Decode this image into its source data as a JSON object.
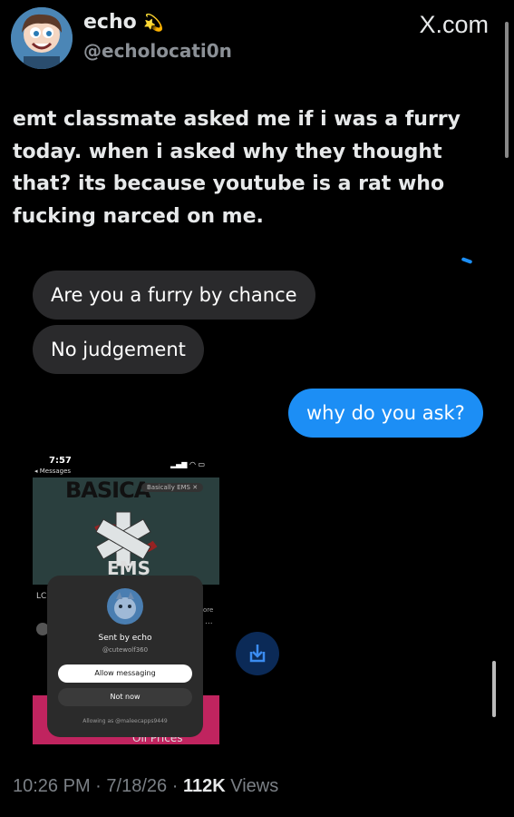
{
  "header": {
    "display_name": "echo",
    "name_emoji": "💫",
    "handle": "@echolocati0n",
    "brand": "X.com"
  },
  "tweet": {
    "lines": [
      "emt classmate asked me if i was a furry",
      "today. when i asked why they thought",
      "that? its because youtube is a rat who",
      "fucking narced on me."
    ]
  },
  "chat": {
    "messages": [
      {
        "text": "Are you a furry by chance",
        "from": "other"
      },
      {
        "text": "No judgement",
        "from": "other"
      },
      {
        "text": "why do you ask?",
        "from": "me"
      }
    ]
  },
  "phone": {
    "time": "7:57",
    "back_label": "◂ Messages",
    "banner_text": "BASICA",
    "pill_text": "Basically EMS",
    "logo_text": "EMS",
    "left_fragment": "LC",
    "right_fragment": "ore",
    "dots": "...",
    "bottom_text": "Oil Prices",
    "modal": {
      "sent_by": "Sent by echo",
      "user": "@cutewolf360",
      "allow_label": "Allow messaging",
      "not_now_label": "Not now",
      "allowing_as": "Allowing as @maleecapps9449"
    }
  },
  "footer": {
    "time": "10:26 PM",
    "date": "7/18/26",
    "views_count": "112K",
    "views_label": "Views"
  },
  "colors": {
    "bubble_gray": "#2a2a2c",
    "bubble_blue": "#1c8ef5",
    "download_button": "#0b2a57"
  }
}
